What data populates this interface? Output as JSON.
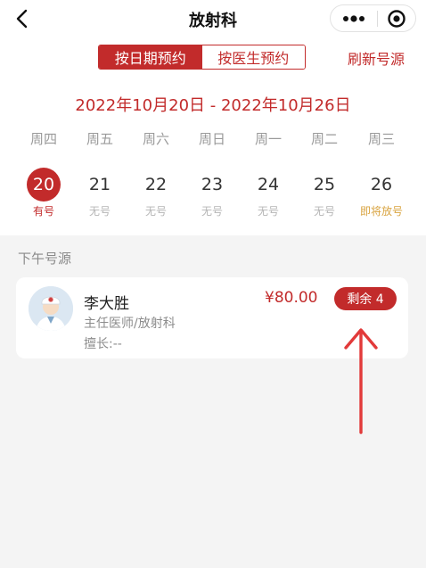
{
  "navbar": {
    "title": "放射科",
    "back_icon": "chevron-left-icon",
    "more_icon": "more-dots-icon",
    "target_icon": "target-circle-icon"
  },
  "tabs": [
    {
      "label": "按日期预约",
      "active": true
    },
    {
      "label": "按医生预约",
      "active": false
    }
  ],
  "refresh_label": "刷新号源",
  "date_range": "2022年10月20日 - 2022年10月26日",
  "days": [
    {
      "weekday": "周四",
      "date": "20",
      "status": "有号",
      "state": "selected"
    },
    {
      "weekday": "周五",
      "date": "21",
      "status": "无号",
      "state": "none"
    },
    {
      "weekday": "周六",
      "date": "22",
      "status": "无号",
      "state": "none"
    },
    {
      "weekday": "周日",
      "date": "23",
      "status": "无号",
      "state": "none"
    },
    {
      "weekday": "周一",
      "date": "24",
      "status": "无号",
      "state": "none"
    },
    {
      "weekday": "周二",
      "date": "25",
      "status": "无号",
      "state": "none"
    },
    {
      "weekday": "周三",
      "date": "26",
      "status": "即将放号",
      "state": "soon"
    }
  ],
  "section_label": "下午号源",
  "doctor": {
    "name": "李大胜",
    "title": "主任医师/放射科",
    "specialty": "擅长:--",
    "price": "¥80.00",
    "remaining": "剩余 4"
  },
  "colors": {
    "accent": "#c22b2b",
    "soon": "#d9a441",
    "muted": "#b5b5b5"
  }
}
